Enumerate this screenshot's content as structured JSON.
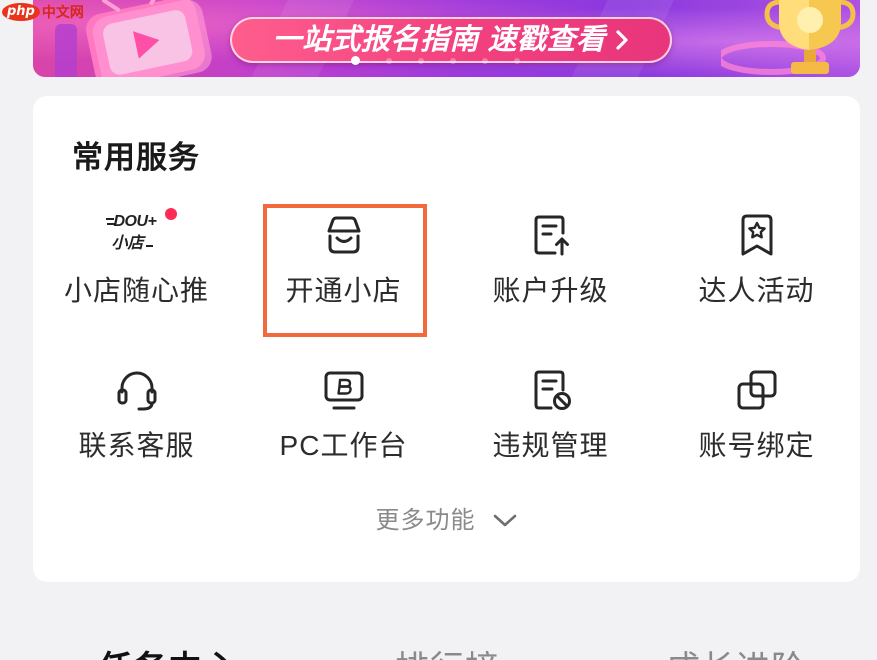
{
  "watermark": {
    "brand_mark": "php",
    "site_name": "中文网"
  },
  "banner": {
    "pill_text": "一站式报名指南 速戳查看",
    "pill_arrow_icon": "chevron-right-icon",
    "illustrations": [
      "tv-play-icon",
      "trophy-icon"
    ]
  },
  "services": {
    "title": "常用服务",
    "items": [
      {
        "label": "小店随心推",
        "icon": "dou-plus-shop-logo",
        "logo": {
          "line1": "DOU+",
          "line2": "小店"
        },
        "badge": "red-dot"
      },
      {
        "label": "开通小店",
        "icon": "store-icon",
        "highlighted": true
      },
      {
        "label": "账户升级",
        "icon": "document-upgrade-icon"
      },
      {
        "label": "达人活动",
        "icon": "bookmark-star-icon"
      },
      {
        "label": "联系客服",
        "icon": "headset-icon"
      },
      {
        "label": "PC工作台",
        "icon": "monitor-icon"
      },
      {
        "label": "违规管理",
        "icon": "document-ban-icon"
      },
      {
        "label": "账号绑定",
        "icon": "link-squares-icon"
      }
    ],
    "more": {
      "label": "更多功能",
      "icon": "chevron-down-icon"
    }
  },
  "bottom_tabs": [
    {
      "label": "任务中心",
      "active": true
    },
    {
      "label": "排行榜",
      "active": false
    },
    {
      "label": "成长进阶",
      "active": false
    }
  ],
  "colors": {
    "page_background": "#f2f2f4",
    "card_background": "#ffffff",
    "text_primary": "#2a2a2a",
    "text_secondary": "#8a8a8a",
    "highlight_border": "#f26a3c",
    "badge": "#fe2c55",
    "pill": "#f2407f",
    "banner_start": "#d944a8",
    "banner_end": "#8b39de"
  }
}
